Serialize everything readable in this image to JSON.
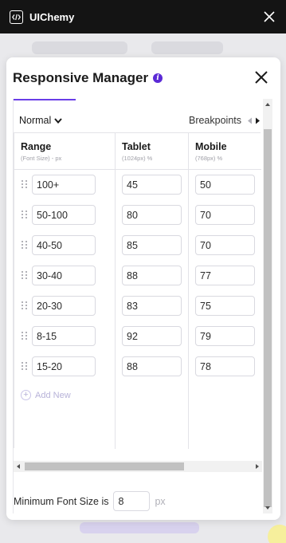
{
  "app": {
    "brand": "UIChemy"
  },
  "panel": {
    "title": "Responsive Manager"
  },
  "controls": {
    "mode": "Normal",
    "breakpoints_label": "Breakpoints"
  },
  "table": {
    "columns": [
      {
        "title": "Range",
        "subtitle": "(Font Size) - px"
      },
      {
        "title": "Tablet",
        "subtitle": "(1024px) %"
      },
      {
        "title": "Mobile",
        "subtitle": "(768px) %"
      }
    ],
    "rows": [
      {
        "range": "100+",
        "tablet": "45",
        "mobile": "50"
      },
      {
        "range": "50-100",
        "tablet": "80",
        "mobile": "70"
      },
      {
        "range": "40-50",
        "tablet": "85",
        "mobile": "70"
      },
      {
        "range": "30-40",
        "tablet": "88",
        "mobile": "77"
      },
      {
        "range": "20-30",
        "tablet": "83",
        "mobile": "75"
      },
      {
        "range": "8-15",
        "tablet": "92",
        "mobile": "79"
      },
      {
        "range": "15-20",
        "tablet": "88",
        "mobile": "78"
      }
    ],
    "add_new_label": "Add New"
  },
  "min_font": {
    "label": "Minimum Font Size is",
    "value": "8",
    "unit": "px"
  },
  "colors": {
    "accent": "#5b2ad6",
    "topbar": "#141414"
  }
}
